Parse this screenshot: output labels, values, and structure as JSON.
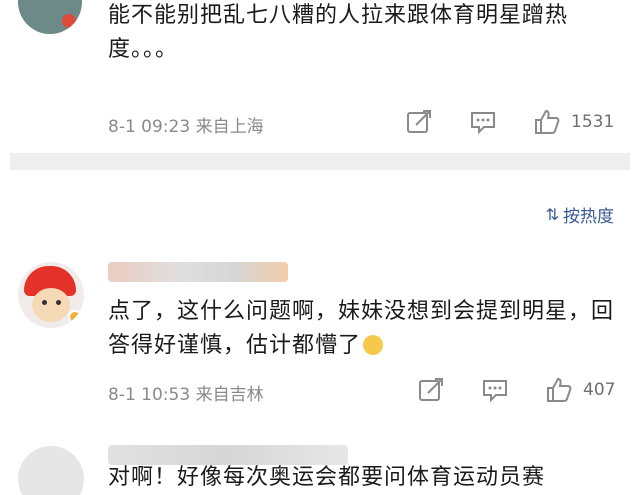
{
  "comments": [
    {
      "text": "能不能别把乱七八糟的人拉来跟体育明星蹭热度。。。",
      "meta": "8-1 09:23 来自上海",
      "likes": "1531",
      "avatar_icon": "user-avatar"
    },
    {
      "text": "点了，这什么问题啊，妹妹没想到会提到明星，回答得好谨慎，估计都懵了",
      "emoji_icon": "speechless-emoji",
      "meta": "8-1 10:53 来自吉林",
      "likes": "407",
      "avatar_icon": "user-avatar"
    },
    {
      "text": "对啊！好像每次奥运会都要问体育运动员赛",
      "avatar_icon": "user-avatar"
    }
  ],
  "sort": {
    "label": "按热度",
    "icon": "sort-icon"
  },
  "colors": {
    "link": "#3a5a96",
    "meta": "#8a8a8a",
    "separator": "#efefef"
  }
}
